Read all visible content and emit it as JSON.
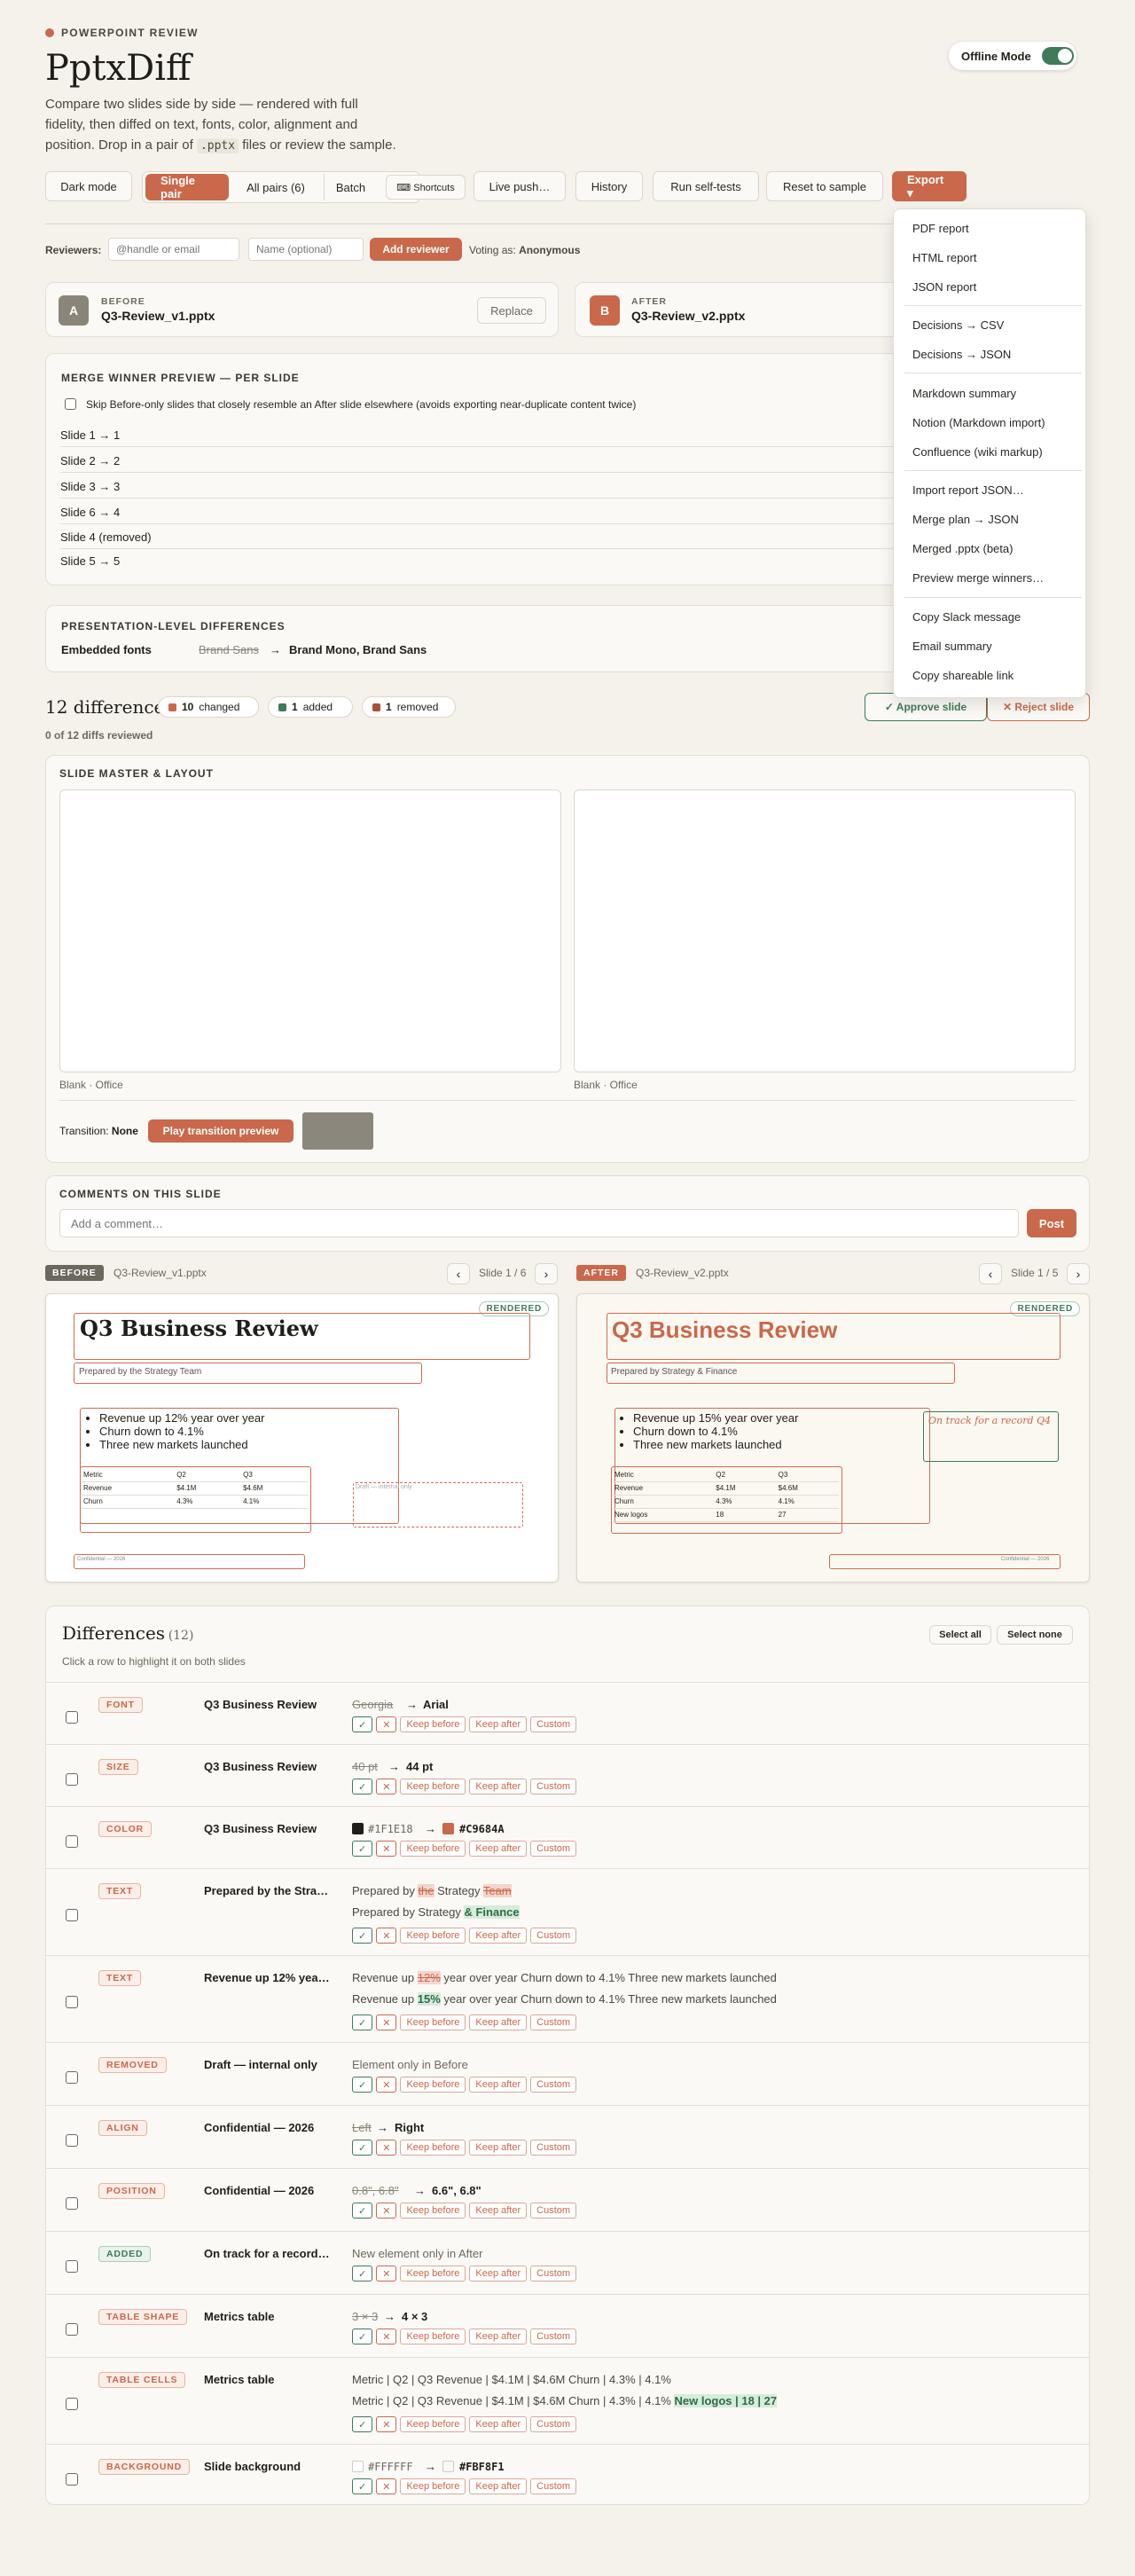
{
  "header": {
    "eyebrow": "POWERPOINT REVIEW",
    "title": "PptxDiff",
    "desc_1": "Compare two slides side by side — rendered with full",
    "desc_2": "fidelity, then diffed on text, fonts, color, alignment and",
    "desc_3a": "position. Drop in a pair of ",
    "desc_code": ".pptx",
    "desc_3b": " files or review the sample.",
    "offline_label": "Offline Mode"
  },
  "toolbar": {
    "dark_mode": "Dark mode",
    "single_pair": "Single pair",
    "all_pairs": "All pairs (6)",
    "batch": "Batch",
    "shortcuts": "⌨ Shortcuts",
    "live_push": "Live push…",
    "history": "History",
    "self_tests": "Run self-tests",
    "reset": "Reset to sample",
    "export": "Export ▾"
  },
  "export_menu": {
    "g1": [
      "PDF report",
      "HTML report",
      "JSON report"
    ],
    "g2": [
      "Decisions → CSV",
      "Decisions → JSON"
    ],
    "g3": [
      "Markdown summary",
      "Notion (Markdown import)",
      "Confluence (wiki markup)"
    ],
    "g4": [
      "Import report JSON…",
      "Merge plan → JSON",
      "Merged .pptx (beta)",
      "Preview merge winners…"
    ],
    "g5": [
      "Copy Slack message",
      "Email summary",
      "Copy shareable link"
    ]
  },
  "reviewers": {
    "label": "Reviewers:",
    "handle_placeholder": "@handle or email",
    "name_placeholder": "Name (optional)",
    "add_button": "Add reviewer",
    "voting_as": "Voting as:",
    "voter": "Anonymous"
  },
  "files": {
    "before_badge": "A",
    "before_label": "BEFORE",
    "before_name": "Q3-Review_v1.pptx",
    "replace": "Replace",
    "after_badge": "B",
    "after_label": "AFTER",
    "after_name": "Q3-Review_v2.pptx"
  },
  "merge": {
    "title": "MERGE WINNER PREVIEW — PER SLIDE",
    "skip_label": "Skip Before-only slides that closely resemble an After slide elsewhere (avoids exporting near-duplicate content twice)",
    "rows": [
      "Slide 1 → 1",
      "Slide 2 → 2",
      "Slide 3 → 3",
      "Slide 6 → 4",
      "Slide 4 (removed)",
      "Slide 5 → 5"
    ]
  },
  "presentation": {
    "title": "PRESENTATION-LEVEL DIFFERENCES",
    "label": "Embedded fonts",
    "old": "Brand Sans",
    "arrow": "→",
    "new": "Brand Mono, Brand Sans"
  },
  "summary": {
    "count_label": "12 differences",
    "changed_n": "10",
    "changed": "changed",
    "added_n": "1",
    "added": "added",
    "removed_n": "1",
    "removed": "removed",
    "reviewed": "0 of 12 diffs reviewed",
    "approve": "✓ Approve slide",
    "reject": "✕ Reject slide"
  },
  "master": {
    "title": "SLIDE MASTER & LAYOUT",
    "left_caption": "Blank · Office",
    "right_caption": "Blank · Office",
    "transition_label": "Transition:",
    "transition_value": "None",
    "play": "Play transition preview"
  },
  "comments": {
    "title": "COMMENTS ON THIS SLIDE",
    "placeholder": "Add a comment…",
    "post": "Post"
  },
  "slides": {
    "before_tag": "BEFORE",
    "before_file": "Q3-Review_v1.pptx",
    "before_counter": "Slide 1 / 6",
    "after_tag": "AFTER",
    "after_file": "Q3-Review_v2.pptx",
    "after_counter": "Slide 1 / 5",
    "rendered": "RENDERED",
    "before": {
      "title": "Q3 Business Review",
      "subtitle": "Prepared by the Strategy Team",
      "bullets": [
        "Revenue up 12% year over year",
        "Churn down to 4.1%",
        "Three new markets launched"
      ],
      "table": [
        [
          "Metric",
          "Q2",
          "Q3"
        ],
        [
          "Revenue",
          "$4.1M",
          "$4.6M"
        ],
        [
          "Churn",
          "4.3%",
          "4.1%"
        ]
      ],
      "draft": "Draft — internal only",
      "confidential": "Confidential — 2026"
    },
    "after": {
      "title": "Q3 Business Review",
      "subtitle": "Prepared by Strategy & Finance",
      "bullets": [
        "Revenue up 15% year over year",
        "Churn down to 4.1%",
        "Three new markets launched"
      ],
      "table": [
        [
          "Metric",
          "Q2",
          "Q3"
        ],
        [
          "Revenue",
          "$4.1M",
          "$4.6M"
        ],
        [
          "Churn",
          "4.3%",
          "4.1%"
        ],
        [
          "New logos",
          "18",
          "27"
        ]
      ],
      "callout": "On track for a record Q4",
      "confidential": "Confidential — 2026"
    }
  },
  "diffs": {
    "title": "Differences",
    "count": "(12)",
    "hint": "Click a row to highlight it on both slides",
    "select_all": "Select all",
    "select_none": "Select none",
    "actions": {
      "ok": "✓",
      "no": "✕",
      "keep_before": "Keep before",
      "keep_after": "Keep after",
      "custom": "Custom"
    },
    "rows": [
      {
        "tag": "FONT",
        "name": "Q3 Business Review",
        "old": "Georgia",
        "new": "Arial"
      },
      {
        "tag": "SIZE",
        "name": "Q3 Business Review",
        "old": "40 pt",
        "new": "44 pt"
      },
      {
        "tag": "COLOR",
        "name": "Q3 Business Review",
        "old": "#1F1E18",
        "new": "#C9684A"
      },
      {
        "tag": "TEXT",
        "name": "Prepared by the Stra…",
        "line1_a": "Prepared by ",
        "line1_del": "the",
        "line1_b": " Strategy ",
        "line1_del2": "Team",
        "line2_a": "Prepared by Strategy ",
        "line2_add": "& Finance"
      },
      {
        "tag": "TEXT",
        "name": "Revenue up 12% yea…",
        "line1_a": "Revenue up ",
        "line1_del": "12%",
        "line1_b": " year over year Churn down to 4.1% Three new markets launched",
        "line2_a": "Revenue up ",
        "line2_add": "15%",
        "line2_b": " year over year Churn down to 4.1% Three new markets launched"
      },
      {
        "tag": "REMOVED",
        "name": "Draft — internal only",
        "note": "Element only in Before"
      },
      {
        "tag": "ALIGN",
        "name": "Confidential — 2026",
        "old": "Left",
        "new": "Right"
      },
      {
        "tag": "POSITION",
        "name": "Confidential — 2026",
        "old": "0.8\", 6.8\"",
        "new": "6.6\", 6.8\""
      },
      {
        "tag": "ADDED",
        "name": "On track for a record…",
        "note": "New element only in After"
      },
      {
        "tag": "TABLE SHAPE",
        "name": "Metrics table",
        "old": "3 × 3",
        "new": "4 × 3"
      },
      {
        "tag": "TABLE CELLS",
        "name": "Metrics table",
        "line1": "Metric | Q2 | Q3 Revenue | $4.1M | $4.6M Churn | 4.3% | 4.1%",
        "line2_a": "Metric | Q2 | Q3 Revenue | $4.1M | $4.6M Churn | 4.3% | 4.1% ",
        "line2_add": "New  logos  |  18  |  27"
      },
      {
        "tag": "BACKGROUND",
        "name": "Slide background",
        "old": "#FFFFFF",
        "new": "#FBF8F1"
      }
    ]
  },
  "colors": {
    "accent": "#C9684A",
    "green": "#3F7A59",
    "bg": "#F5F2EC",
    "old_color": "#1F1E18"
  }
}
